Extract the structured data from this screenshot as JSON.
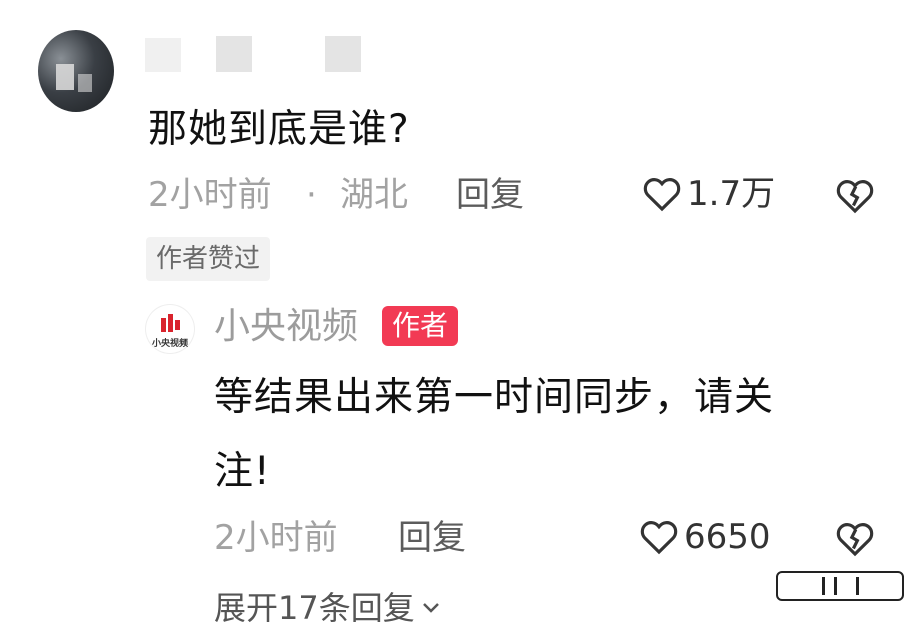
{
  "top_comment": {
    "text": "那她到底是谁?",
    "time": "2小时前",
    "separator": "·",
    "location": "湖北",
    "reply_label": "回复",
    "likes": "1.7万",
    "author_liked_badge": "作者赞过"
  },
  "reply": {
    "author_name": "小央视频",
    "author_tag": "作者",
    "logo_text": "小央视频",
    "text_line1": "等结果出来第一时间同步，请关",
    "text_line2": "注!",
    "time": "2小时前",
    "reply_label": "回复",
    "likes": "6650"
  },
  "expand_link": "展开17条回复",
  "colors": {
    "author_tag": "#f23a54",
    "meta": "#a2a2a2",
    "text": "#111111"
  },
  "icons": [
    "heart-icon",
    "broken-heart-icon",
    "chevron-down-icon"
  ]
}
